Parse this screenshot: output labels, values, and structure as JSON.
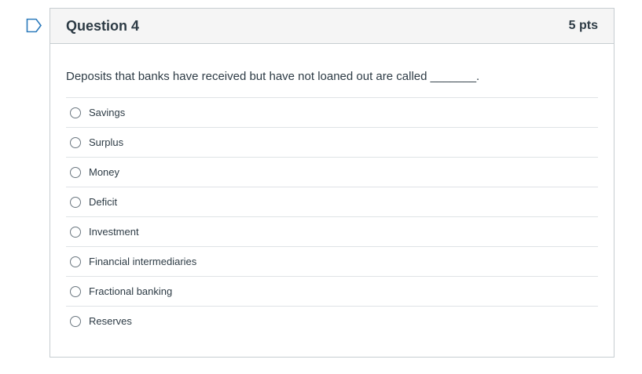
{
  "question": {
    "title": "Question 4",
    "points": "5 pts",
    "text": "Deposits that banks have received but have not loaned out are called _______.",
    "answers": [
      {
        "label": "Savings",
        "selected": false
      },
      {
        "label": "Surplus",
        "selected": false
      },
      {
        "label": "Money",
        "selected": false
      },
      {
        "label": "Deficit",
        "selected": false
      },
      {
        "label": "Investment",
        "selected": false
      },
      {
        "label": "Financial intermediaries",
        "selected": false
      },
      {
        "label": "Fractional banking",
        "selected": false
      },
      {
        "label": "Reserves",
        "selected": false
      }
    ]
  },
  "icons": {
    "flag": "bookmark-flag-icon"
  },
  "colors": {
    "flag": "#2b7abc",
    "header_background": "#f5f5f5",
    "border": "#c7cdd1",
    "text": "#2d3b45"
  }
}
